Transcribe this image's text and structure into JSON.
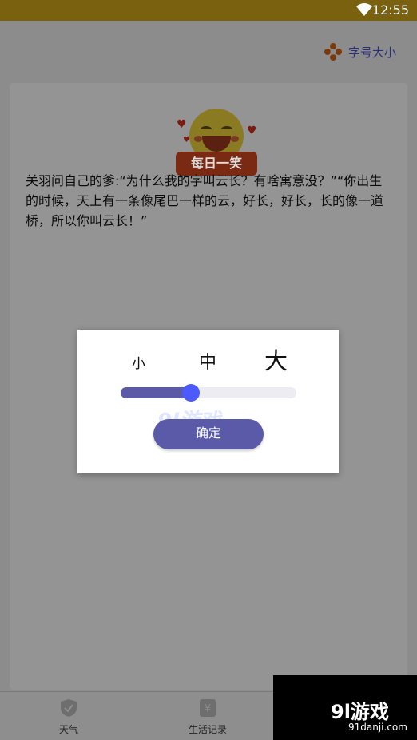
{
  "status_bar": {
    "time": "12:55"
  },
  "header": {
    "font_size_label": "字号大小"
  },
  "card": {
    "badge": "每日一笑",
    "joke": "关羽问自己的爹:“为什么我的字叫云长？有啥寓意没？”“你出生的时候，天上有一条像尾巴一样的云，好长，好长，长的像一道桥，所以你叫云长！”"
  },
  "bottom_nav": {
    "items": [
      "天气",
      "生活记录"
    ]
  },
  "watermark": {
    "brand": "9l游戏",
    "domain": "91danji.com"
  },
  "dialog": {
    "small": "小",
    "medium": "中",
    "large": "大",
    "slider_level": 0.4,
    "confirm": "确定",
    "watermark": "9l游戏"
  },
  "colors": {
    "accent": "#5a5aa8",
    "thumb": "#4b5bff"
  }
}
